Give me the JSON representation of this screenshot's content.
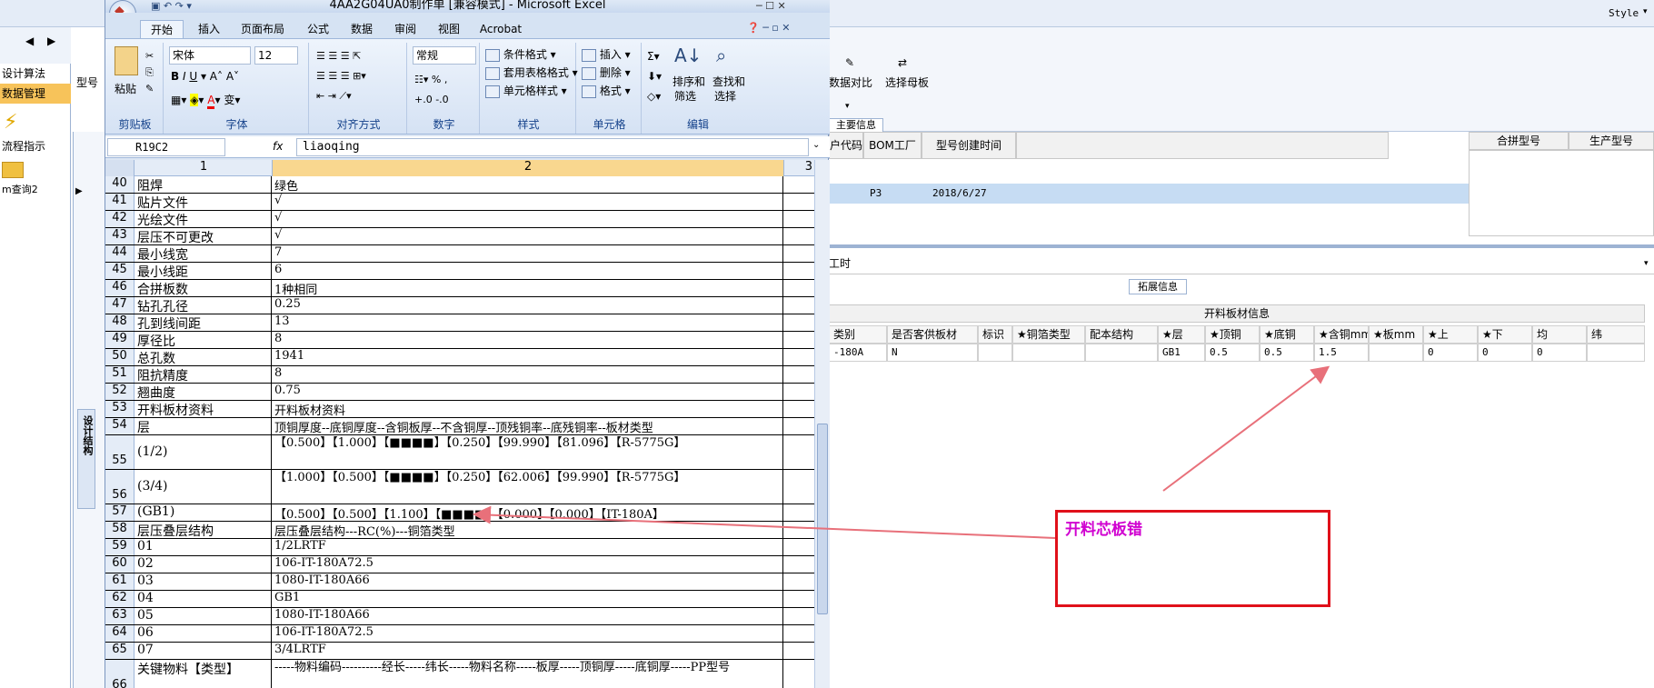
{
  "left_app": {
    "nav_arrow_left": "◀",
    "nav_arrow_right": "▶",
    "model_prefix": "型号",
    "side_items": [
      "设计算法",
      "数据管理",
      "流程指示",
      "m查询2"
    ],
    "vertical_tab": "设计结构",
    "row_marker": "▶"
  },
  "right_app": {
    "style_label": "Style",
    "tool_data_compare": "数据对比",
    "tool_select_mother": "选择母板",
    "main_info_tab": "主要信息",
    "grid_headers": [
      "户代码",
      "BOM工厂",
      "型号创建时间"
    ],
    "grid_headers_right": [
      "合拼型号",
      "生产型号"
    ],
    "grid_row": {
      "bom_factory": "P3",
      "created": "2018/6/27"
    },
    "worktime_label": "工时",
    "ext_info_tab": "拓展信息",
    "cut_info_title": "开料板材信息",
    "cut_headers": [
      "类别",
      "是否客供板材",
      "标识",
      "★铜箔类型",
      "配本结构",
      "★层",
      "★顶铜",
      "★底铜",
      "★含铜mm",
      "★板mm",
      "★上",
      "★下",
      "均",
      "纬"
    ],
    "cut_row": [
      "-180A",
      "N",
      "",
      "",
      "",
      "GB1",
      "0.5",
      "0.5",
      "1.5",
      "",
      "0",
      "0",
      "0",
      ""
    ]
  },
  "excel": {
    "title": "4AA2G04UA0制作单 [兼容模式] - Microsoft Excel",
    "tabs": [
      "开始",
      "插入",
      "页面布局",
      "公式",
      "数据",
      "审阅",
      "视图",
      "Acrobat"
    ],
    "ribbon": {
      "clipboard": {
        "paste": "粘贴",
        "label": "剪贴板"
      },
      "font": {
        "name": "宋体",
        "size": "12",
        "label": "字体"
      },
      "align": {
        "label": "对齐方式"
      },
      "number": {
        "format": "常规",
        "label": "数字"
      },
      "styles": {
        "cond": "条件格式",
        "table": "套用表格格式",
        "cell": "单元格样式",
        "label": "样式"
      },
      "cells": {
        "insert": "插入",
        "delete": "删除",
        "format": "格式",
        "label": "单元格"
      },
      "edit": {
        "sort": "排序和",
        "sort2": "筛选",
        "find": "查找和",
        "find2": "选择",
        "label": "编辑"
      }
    },
    "name_box": "R19C2",
    "fx": "fx",
    "formula": "liaoqing",
    "col_headers": [
      "1",
      "2",
      "3"
    ],
    "rows": [
      {
        "n": "40",
        "a": "阻焊",
        "b": "绿色"
      },
      {
        "n": "41",
        "a": "贴片文件",
        "b": "√"
      },
      {
        "n": "42",
        "a": "光绘文件",
        "b": "√"
      },
      {
        "n": "43",
        "a": "层压不可更改",
        "b": "√"
      },
      {
        "n": "44",
        "a": "最小线宽",
        "b": "7"
      },
      {
        "n": "45",
        "a": "最小线距",
        "b": "6"
      },
      {
        "n": "46",
        "a": "合拼板数",
        "b": "1种相同"
      },
      {
        "n": "47",
        "a": "钻孔孔径",
        "b": "0.25"
      },
      {
        "n": "48",
        "a": "孔到线间距",
        "b": "13"
      },
      {
        "n": "49",
        "a": "厚径比",
        "b": "8"
      },
      {
        "n": "50",
        "a": "总孔数",
        "b": "1941"
      },
      {
        "n": "51",
        "a": "阻抗精度",
        "b": "8"
      },
      {
        "n": "52",
        "a": "翘曲度",
        "b": "0.75"
      },
      {
        "n": "53",
        "a": "开料板材资料",
        "b": "开料板材资料"
      },
      {
        "n": "54",
        "a": "层",
        "b": "顶铜厚度--底铜厚度--含铜板厚--不含铜厚--顶残铜率--底残铜率--板材类型"
      },
      {
        "n": "55",
        "a": "(1/2)",
        "b": "【0.500】【1.000】【■■■■】【0.250】【99.990】【81.096】【R-5775G】"
      },
      {
        "n": "56",
        "a": "(3/4)",
        "b": "【1.000】【0.500】【■■■■】【0.250】【62.006】【99.990】【R-5775G】"
      },
      {
        "n": "57",
        "a": "(GB1)",
        "b": "【0.500】【0.500】【1.100】【■■■■】【0.000】【0.000】【IT-180A】"
      },
      {
        "n": "58",
        "a": "层压叠层结构",
        "b": "层压叠层结构---RC(%)---铜箔类型"
      },
      {
        "n": "59",
        "a": "01",
        "b": "1/2LRTF"
      },
      {
        "n": "60",
        "a": "02",
        "b": "106-IT-180A72.5"
      },
      {
        "n": "61",
        "a": "03",
        "b": "1080-IT-180A66"
      },
      {
        "n": "62",
        "a": "04",
        "b": "GB1"
      },
      {
        "n": "63",
        "a": "05",
        "b": "1080-IT-180A66"
      },
      {
        "n": "64",
        "a": "06",
        "b": "106-IT-180A72.5"
      },
      {
        "n": "65",
        "a": "07",
        "b": "3/4LRTF"
      },
      {
        "n": "66",
        "a": "关键物料【类型】",
        "b": "-----物料编码----------经长-----纬长-----物料名称-----板厚-----顶铜厚-----底铜厚-----PP型号"
      }
    ]
  },
  "annotation": {
    "text": "开料芯板错",
    "color": "#d000d0",
    "box_color": "#e0101a",
    "arrow_color": "#e8707a"
  }
}
